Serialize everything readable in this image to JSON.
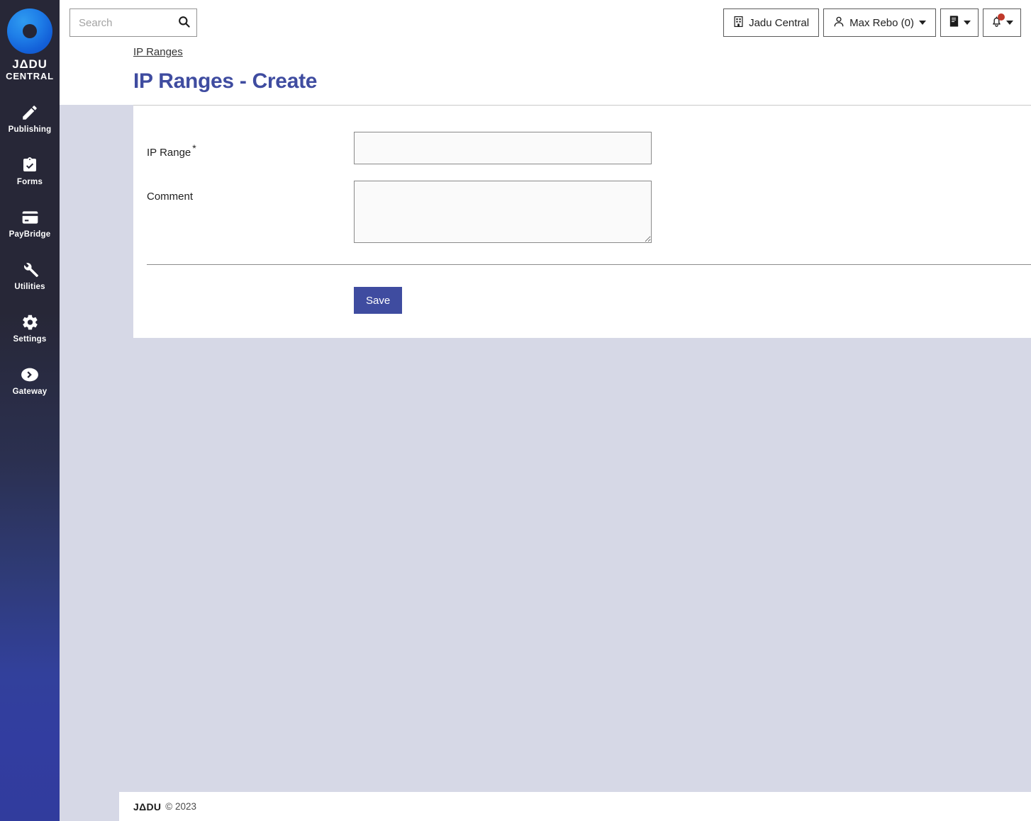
{
  "brand": {
    "line1": "JΔDU",
    "line2": "CENTRAL",
    "logo_icon": "jadu-ring-logo"
  },
  "sidebar": {
    "items": [
      {
        "label": "Publishing",
        "icon": "pencil-icon"
      },
      {
        "label": "Forms",
        "icon": "clipboard-check-icon"
      },
      {
        "label": "PayBridge",
        "icon": "credit-card-icon"
      },
      {
        "label": "Utilities",
        "icon": "wrench-icon"
      },
      {
        "label": "Settings",
        "icon": "gear-icon"
      },
      {
        "label": "Gateway",
        "icon": "chevron-right-circle-icon"
      }
    ]
  },
  "topbar": {
    "search": {
      "value": "",
      "placeholder": "Search",
      "button_icon": "search-icon"
    },
    "site_button": {
      "label": "Jadu Central",
      "icon": "building-icon"
    },
    "user_button": {
      "label": "Max Rebo (0)",
      "icon": "user-icon",
      "caret": "caret-down-icon"
    },
    "book_button": {
      "icon": "book-icon",
      "caret": "caret-down-icon"
    },
    "notifications_button": {
      "icon": "bell-icon",
      "caret": "caret-down-icon",
      "has_alert": true,
      "alert_color": "#c0392b"
    }
  },
  "breadcrumb": {
    "item": "IP Ranges"
  },
  "page": {
    "title": "IP Ranges - Create",
    "title_color": "#3f4ca0"
  },
  "form": {
    "fields": [
      {
        "label": "IP Range",
        "required_marker": "*",
        "value": "",
        "placeholder": "",
        "type": "text"
      },
      {
        "label": "Comment",
        "required_marker": "",
        "value": "",
        "placeholder": "",
        "type": "textarea"
      }
    ],
    "save_label": "Save",
    "save_color": "#3f4ca0"
  },
  "footer": {
    "logo": "JΔDU",
    "copyright": "© 2023"
  }
}
